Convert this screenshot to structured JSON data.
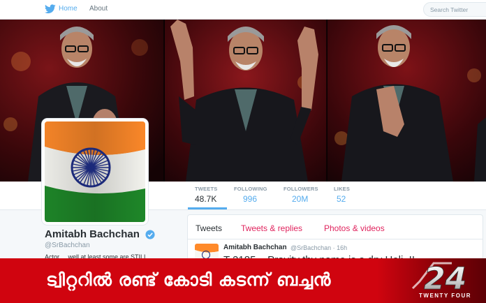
{
  "nav": {
    "home_label": "Home",
    "about_label": "About",
    "search_placeholder": "Search Twitter"
  },
  "profile": {
    "name": "Amitabh Bachchan",
    "handle": "@SrBachchan",
    "bio_partial": "Actor ... well at least some are STILL"
  },
  "stats": [
    {
      "label": "TWEETS",
      "value": "48.7K"
    },
    {
      "label": "FOLLOWING",
      "value": "996"
    },
    {
      "label": "FOLLOWERS",
      "value": "20M"
    },
    {
      "label": "LIKES",
      "value": "52"
    }
  ],
  "timeline": {
    "tabs": [
      "Tweets",
      "Tweets & replies",
      "Photos & videos"
    ],
    "tweet": {
      "author": "Amitabh Bachchan",
      "handle_time": "@SrBachchan · 16h",
      "text": "T 2185 – Pravity thy name is a dry Holi..!!"
    }
  },
  "news": {
    "headline": "ട്വിറ്ററിൽ രണ്ട് കോടി കടന്ന് ബച്ചൻ",
    "logo_number": "24",
    "logo_sub": "TWENTY FOUR"
  },
  "colors": {
    "accent": "#55acee",
    "tab_red": "#e0245e",
    "band_red": "#d0040f",
    "saffron": "#ff9933",
    "green": "#138808",
    "chakra_blue": "#1c2a7a"
  },
  "icons": {
    "logo": "twitter-bird-icon",
    "verified": "verified-badge-icon",
    "channel_logo": "24-news-logo"
  }
}
